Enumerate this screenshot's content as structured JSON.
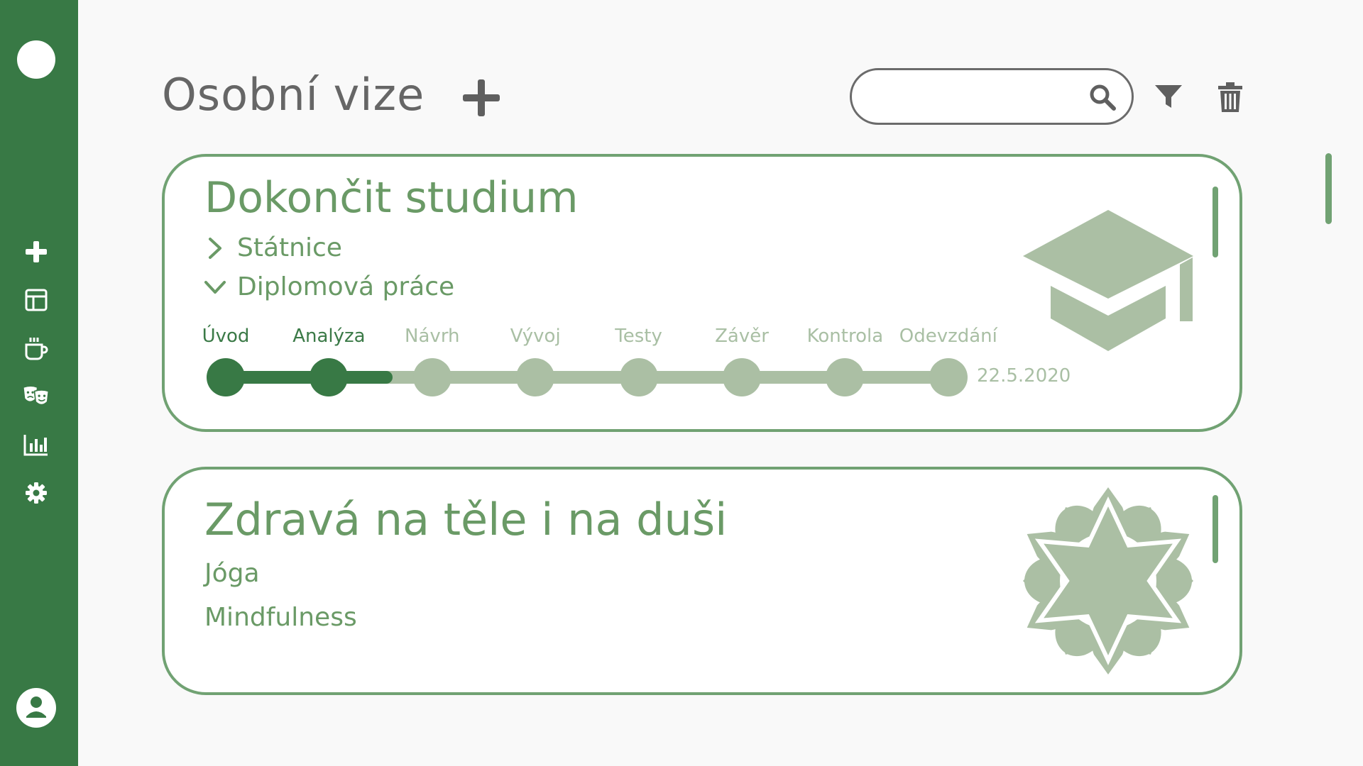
{
  "page": {
    "title": "Osobní vize"
  },
  "search": {
    "placeholder": "",
    "value": ""
  },
  "colors": {
    "sidebar": "#387945",
    "accent": "#71a273",
    "text_green": "#6a9a66",
    "light_green": "#abbfa4",
    "dark_green": "#387945"
  },
  "sidebar": {
    "items": [
      {
        "icon": "plus-icon"
      },
      {
        "icon": "layout-icon"
      },
      {
        "icon": "coffee-cup-icon"
      },
      {
        "icon": "theater-masks-icon"
      },
      {
        "icon": "bar-chart-icon"
      },
      {
        "icon": "gear-icon"
      }
    ],
    "user_icon": "user-icon"
  },
  "toolbar": {
    "icons": [
      "plus-icon",
      "search-icon",
      "filter-icon",
      "trash-icon"
    ]
  },
  "cards": [
    {
      "title": "Dokončit studium",
      "image_icon": "graduation-cap-icon",
      "subitems": [
        {
          "label": "Státnice",
          "state": "collapsed"
        },
        {
          "label": "Diplomová práce",
          "state": "expanded"
        }
      ],
      "stages": [
        "Úvod",
        "Analýza",
        "Návrh",
        "Vývoj",
        "Testy",
        "Závěr",
        "Kontrola",
        "Odevzdání"
      ],
      "completed_stages": 2,
      "due_date": "22.5.2020"
    },
    {
      "title": "Zdravá na těle i na duši",
      "image_icon": "lotus-mandala-icon",
      "items": [
        "Jóga",
        "Mindfulness"
      ]
    }
  ]
}
